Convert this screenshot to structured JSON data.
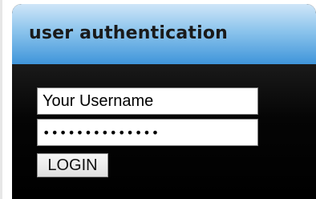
{
  "panel": {
    "title": "user authentication"
  },
  "form": {
    "username_value": "Your Username",
    "password_value": "••••••••••••••",
    "login_label": "LOGIN"
  }
}
